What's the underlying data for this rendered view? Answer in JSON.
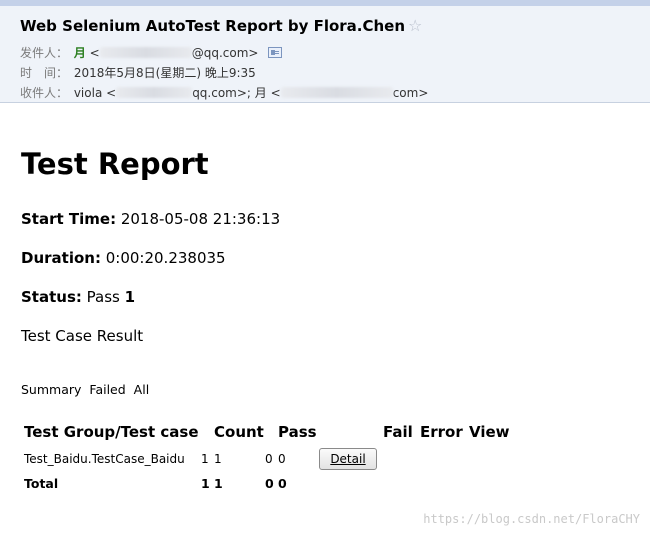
{
  "email": {
    "subject": "Web Selenium AutoTest Report by Flora.Chen",
    "star_icon": "star-outline-icon",
    "from_label": "发件人：",
    "from_name": "月",
    "from_addr_open": "<",
    "from_addr_suffix": "@qq.com>",
    "contact_card_icon": "contact-card-icon",
    "time_label": "时　间：",
    "time_value": "2018年5月8日(星期二) 晚上9:35",
    "to_label": "收件人：",
    "to_first_name": "viola",
    "to_first_open": "<",
    "to_first_suffix": "qq.com>;",
    "to_second_name": "月",
    "to_second_open": "<",
    "to_second_suffix": "com>"
  },
  "report": {
    "title": "Test Report",
    "start_label": "Start Time:",
    "start_value": "2018-05-08 21:36:13",
    "duration_label": "Duration:",
    "duration_value": "0:00:20.238035",
    "status_label": "Status:",
    "status_value": "Pass",
    "status_count": "1",
    "case_result": "Test Case Result",
    "filters": [
      "Summary",
      "Failed",
      "All"
    ]
  },
  "table": {
    "headers": [
      "Test Group/Test case",
      "Count",
      "Pass",
      "Fail",
      "Error",
      "View"
    ],
    "row": {
      "name": "Test_Baidu.TestCase_Baidu",
      "count": "1",
      "pass": "1",
      "fail": "0",
      "error": "0",
      "view_label": "Detail"
    },
    "total": {
      "label": "Total",
      "count": "1",
      "pass": "1",
      "fail": "0",
      "error": "0"
    }
  },
  "watermark": "https://blog.csdn.net/FloraCHY"
}
